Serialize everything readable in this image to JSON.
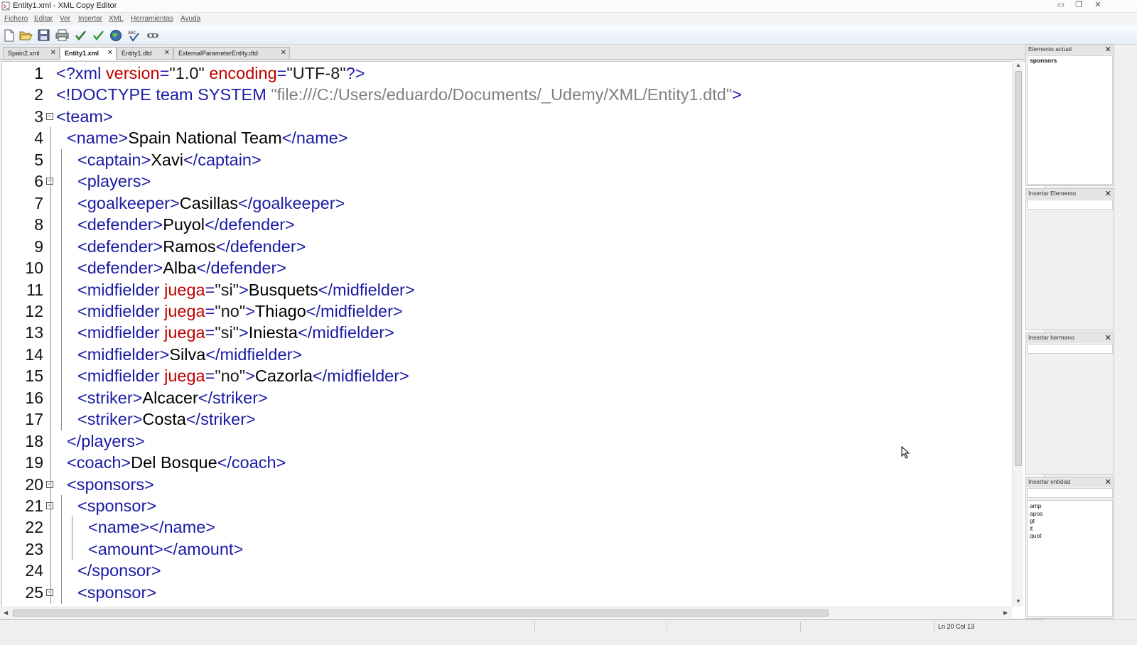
{
  "window": {
    "title": "Entity1.xml - XML Copy Editor"
  },
  "menu": [
    "Fichero",
    "Editar",
    "Ver",
    "Insertar",
    "XML",
    "Herramientas",
    "Ayuda"
  ],
  "toolbar": [
    "new-file-icon",
    "open-folder-icon",
    "save-icon",
    "print-icon",
    "check-wellformed-icon",
    "validate-icon",
    "browser-icon",
    "spellcheck-icon",
    "xpath-icon"
  ],
  "tabs": [
    {
      "label": "Spain2.xml",
      "active": false
    },
    {
      "label": "Entity1.xml",
      "active": true
    },
    {
      "label": "Entity1.dtd",
      "active": false
    },
    {
      "label": "ExternalParameterEntity.dtd",
      "active": false
    }
  ],
  "editor": {
    "lines": [
      {
        "n": "1",
        "fold": false,
        "depth": 0,
        "tokens": [
          [
            "pi",
            "<?xml "
          ],
          [
            "a",
            "version"
          ],
          [
            "pi",
            "="
          ],
          [
            "s",
            "\"1.0\" "
          ],
          [
            "a",
            "encoding"
          ],
          [
            "pi",
            "="
          ],
          [
            "s",
            "\"UTF-8\""
          ],
          [
            "pi",
            "?>"
          ]
        ]
      },
      {
        "n": "2",
        "fold": false,
        "depth": 0,
        "tokens": [
          [
            "t",
            "<!DOCTYPE team SYSTEM "
          ],
          [
            "gray",
            "\"file:///C:/Users/eduardo/Documents/_Udemy/XML/Entity1.dtd\""
          ],
          [
            "t",
            ">"
          ]
        ]
      },
      {
        "n": "3",
        "fold": true,
        "depth": 0,
        "tokens": [
          [
            "t",
            "<team>"
          ]
        ]
      },
      {
        "n": "4",
        "fold": false,
        "depth": 1,
        "tokens": [
          [
            "t",
            "<name>"
          ],
          [
            "txt",
            "Spain National Team"
          ],
          [
            "t",
            "</name>"
          ]
        ]
      },
      {
        "n": "5",
        "fold": false,
        "depth": 2,
        "tokens": [
          [
            "t",
            "<captain>"
          ],
          [
            "txt",
            "Xavi"
          ],
          [
            "t",
            "</captain>"
          ]
        ]
      },
      {
        "n": "6",
        "fold": true,
        "depth": 2,
        "tokens": [
          [
            "t",
            "<players>"
          ]
        ]
      },
      {
        "n": "7",
        "fold": false,
        "depth": 2,
        "tokens": [
          [
            "t",
            "<goalkeeper>"
          ],
          [
            "txt",
            "Casillas"
          ],
          [
            "t",
            "</goalkeeper>"
          ]
        ]
      },
      {
        "n": "8",
        "fold": false,
        "depth": 2,
        "tokens": [
          [
            "t",
            "<defender>"
          ],
          [
            "txt",
            "Puyol"
          ],
          [
            "t",
            "</defender>"
          ]
        ]
      },
      {
        "n": "9",
        "fold": false,
        "depth": 2,
        "tokens": [
          [
            "t",
            "<defender>"
          ],
          [
            "txt",
            "Ramos"
          ],
          [
            "t",
            "</defender>"
          ]
        ]
      },
      {
        "n": "10",
        "fold": false,
        "depth": 2,
        "tokens": [
          [
            "t",
            "<defender>"
          ],
          [
            "txt",
            "Alba"
          ],
          [
            "t",
            "</defender>"
          ]
        ]
      },
      {
        "n": "11",
        "fold": false,
        "depth": 2,
        "tokens": [
          [
            "t",
            "<midfielder "
          ],
          [
            "a",
            "juega"
          ],
          [
            "t",
            "="
          ],
          [
            "s",
            "\"si\""
          ],
          [
            "t",
            ">"
          ],
          [
            "txt",
            "Busquets"
          ],
          [
            "t",
            "</midfielder>"
          ]
        ]
      },
      {
        "n": "12",
        "fold": false,
        "depth": 2,
        "tokens": [
          [
            "t",
            "<midfielder "
          ],
          [
            "a",
            "juega"
          ],
          [
            "t",
            "="
          ],
          [
            "s",
            "\"no\""
          ],
          [
            "t",
            ">"
          ],
          [
            "txt",
            "Thiago"
          ],
          [
            "t",
            "</midfielder>"
          ]
        ]
      },
      {
        "n": "13",
        "fold": false,
        "depth": 2,
        "tokens": [
          [
            "t",
            "<midfielder "
          ],
          [
            "a",
            "juega"
          ],
          [
            "t",
            "="
          ],
          [
            "s",
            "\"si\""
          ],
          [
            "t",
            ">"
          ],
          [
            "txt",
            "Iniesta"
          ],
          [
            "t",
            "</midfielder>"
          ]
        ]
      },
      {
        "n": "14",
        "fold": false,
        "depth": 2,
        "tokens": [
          [
            "t",
            "<midfielder>"
          ],
          [
            "txt",
            "Silva"
          ],
          [
            "t",
            "</midfielder>"
          ]
        ]
      },
      {
        "n": "15",
        "fold": false,
        "depth": 2,
        "tokens": [
          [
            "t",
            "<midfielder "
          ],
          [
            "a",
            "juega"
          ],
          [
            "t",
            "="
          ],
          [
            "s",
            "\"no\""
          ],
          [
            "t",
            ">"
          ],
          [
            "txt",
            "Cazorla"
          ],
          [
            "t",
            "</midfielder>"
          ]
        ]
      },
      {
        "n": "16",
        "fold": false,
        "depth": 2,
        "tokens": [
          [
            "t",
            "<striker>"
          ],
          [
            "txt",
            "Alcacer"
          ],
          [
            "t",
            "</striker>"
          ]
        ]
      },
      {
        "n": "17",
        "fold": false,
        "depth": 2,
        "tokens": [
          [
            "t",
            "<striker>"
          ],
          [
            "txt",
            "Costa"
          ],
          [
            "t",
            "</striker>"
          ]
        ]
      },
      {
        "n": "18",
        "fold": false,
        "depth": 1,
        "tokens": [
          [
            "t",
            "</players>"
          ]
        ]
      },
      {
        "n": "19",
        "fold": false,
        "depth": 1,
        "tokens": [
          [
            "t",
            "<coach>"
          ],
          [
            "txt",
            "Del Bosque"
          ],
          [
            "t",
            "</coach>"
          ]
        ]
      },
      {
        "n": "20",
        "fold": true,
        "depth": 1,
        "tokens": [
          [
            "t",
            "<sponsors>"
          ]
        ]
      },
      {
        "n": "21",
        "fold": true,
        "depth": 2,
        "tokens": [
          [
            "t",
            "<sponsor>"
          ]
        ]
      },
      {
        "n": "22",
        "fold": false,
        "depth": 3,
        "tokens": [
          [
            "t",
            "<name></name>"
          ]
        ]
      },
      {
        "n": "23",
        "fold": false,
        "depth": 3,
        "tokens": [
          [
            "t",
            "<amount></amount>"
          ]
        ]
      },
      {
        "n": "24",
        "fold": false,
        "depth": 2,
        "tokens": [
          [
            "t",
            "</sponsor>"
          ]
        ]
      },
      {
        "n": "25",
        "fold": true,
        "depth": 2,
        "tokens": [
          [
            "t",
            "<sponsor>"
          ]
        ]
      }
    ]
  },
  "panes": {
    "current_element": {
      "title": "Elemento actual",
      "value": "sponsors"
    },
    "insert_element": {
      "title": "Insertar Elemento"
    },
    "insert_sibling": {
      "title": "Insertar hermano"
    },
    "insert_entity": {
      "title": "Insertar entidad",
      "items": [
        "amp",
        "apos",
        "gt",
        "lt",
        "quot"
      ]
    }
  },
  "status": {
    "position": "Ln 20 Col 13"
  },
  "colors": {
    "tag": "#1a1aa6",
    "attribute": "#c00000",
    "doctype_path": "#808080"
  }
}
